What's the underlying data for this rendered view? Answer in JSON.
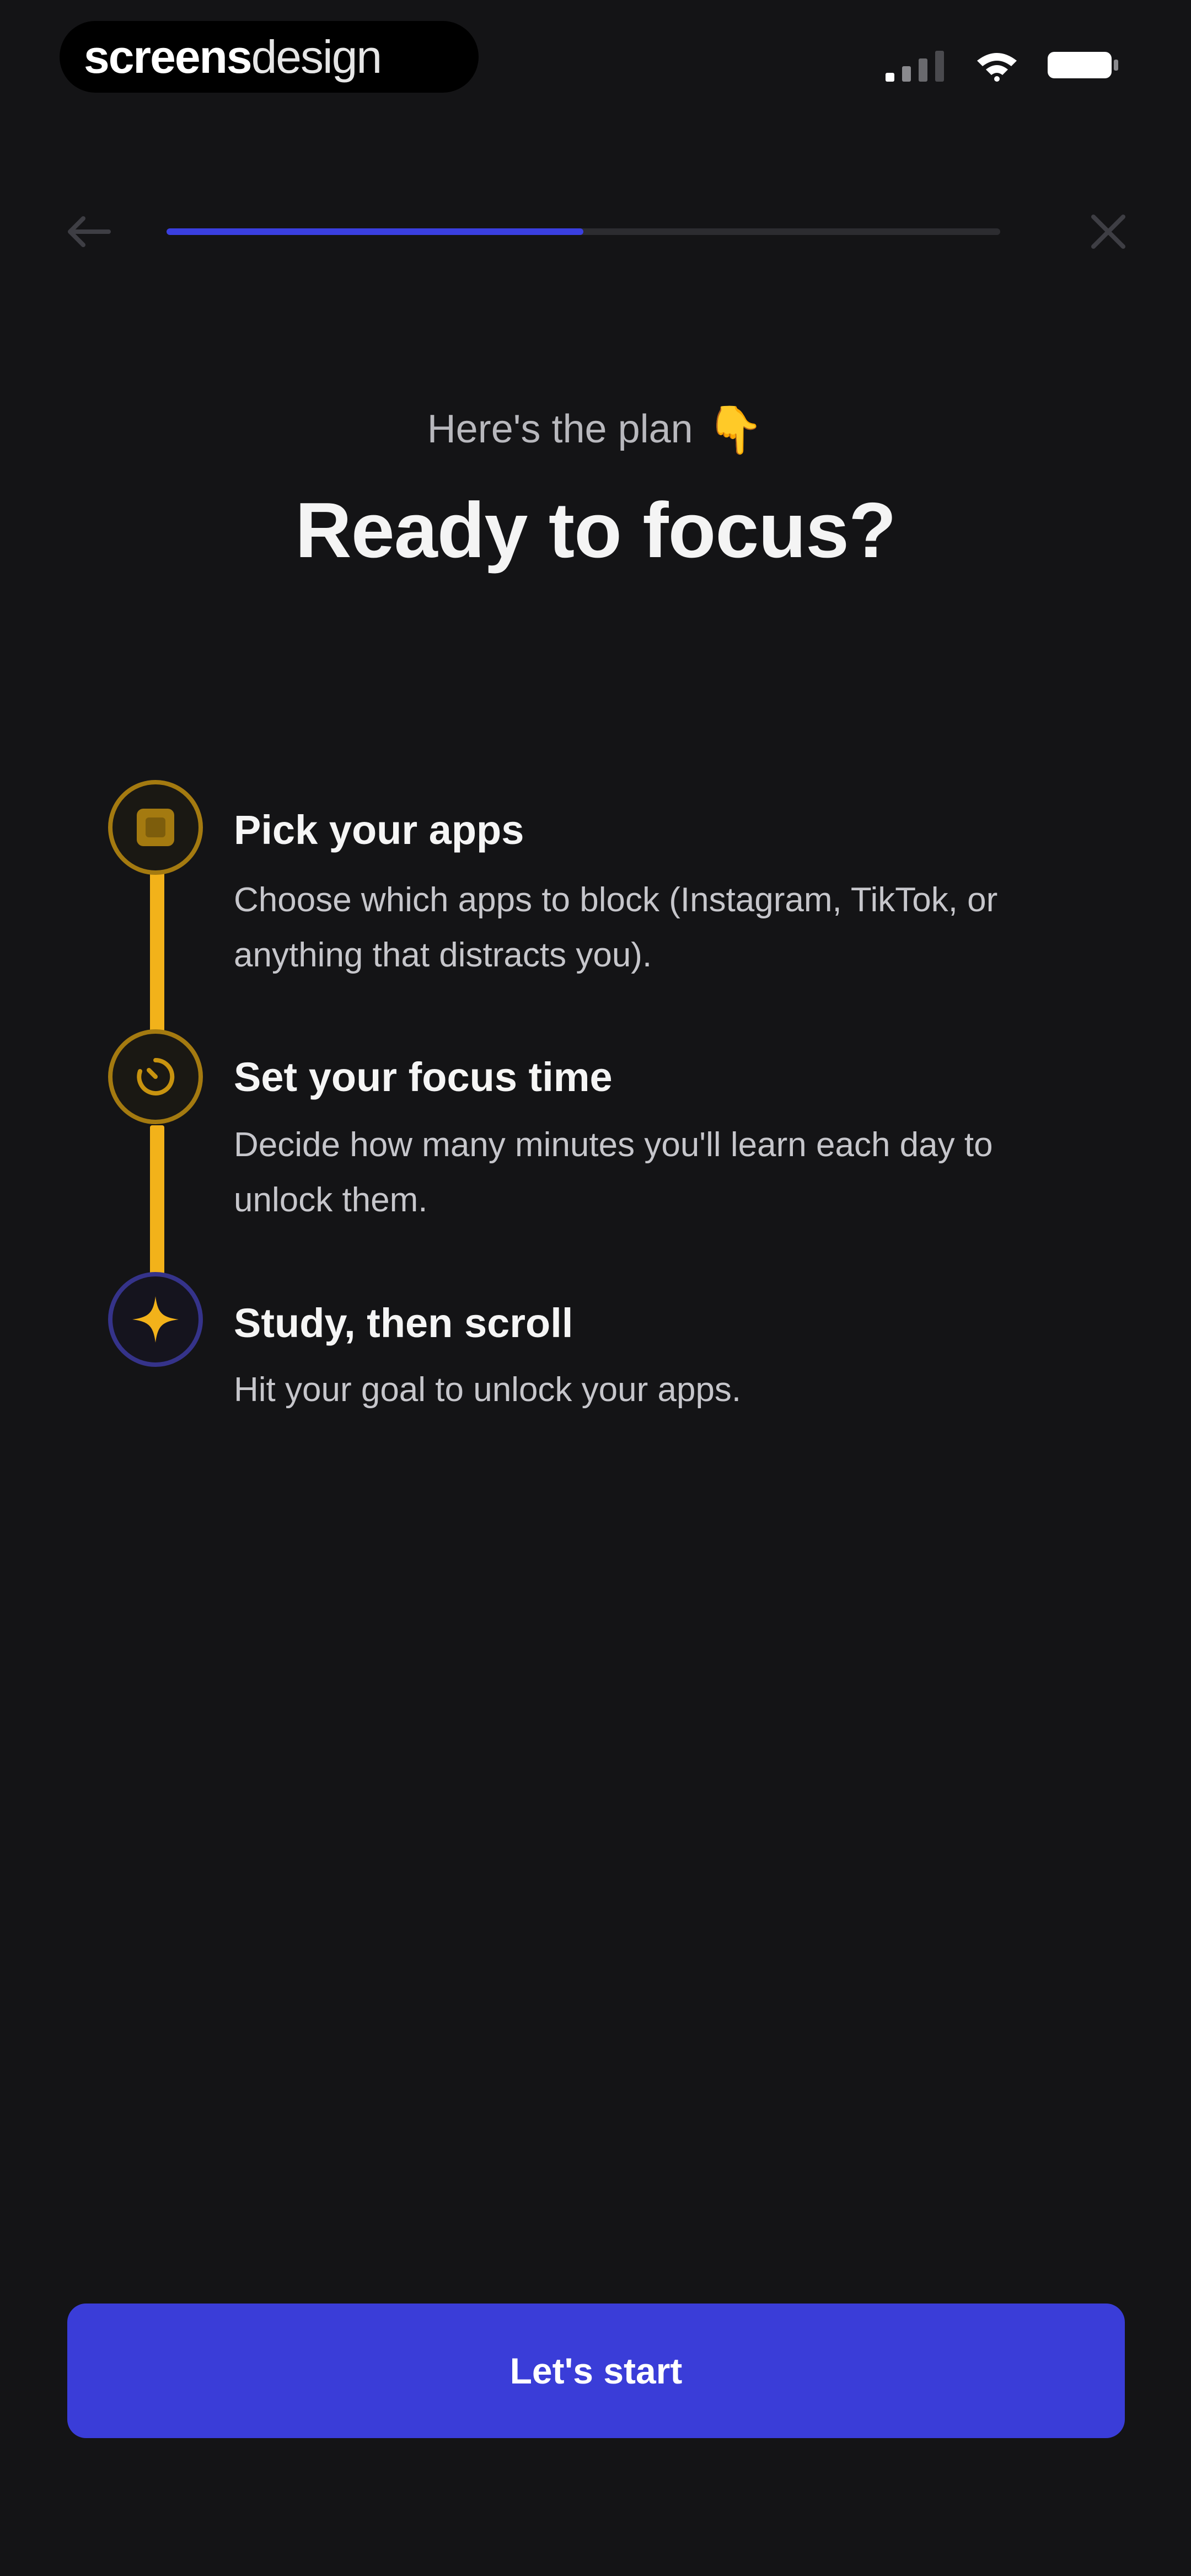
{
  "status_bar": {
    "brand": {
      "bold": "screens",
      "light": "design"
    },
    "icons": [
      "cellular-signal-icon",
      "wifi-icon",
      "battery-icon"
    ]
  },
  "nav": {
    "back_icon": "arrow-left-icon",
    "close_icon": "close-icon",
    "progress_fraction": 0.5
  },
  "header": {
    "eyebrow": "Here's the plan",
    "eyebrow_emoji": "👇",
    "title": "Ready to focus?"
  },
  "steps": [
    {
      "icon": "app-grid-icon",
      "title": "Pick your apps",
      "description": "Choose which apps to block (Instagram, TikTok, or anything that distracts you)."
    },
    {
      "icon": "timer-icon",
      "title": "Set your focus time",
      "description": "Decide how many minutes you'll learn each day to unlock them."
    },
    {
      "icon": "sparkle-icon",
      "title": "Study, then scroll",
      "description": "Hit your goal to unlock your apps."
    }
  ],
  "cta": {
    "label": "Let's start"
  },
  "colors": {
    "background": "#141416",
    "accent_blue": "#3a3dd8",
    "accent_gold": "#f2b21a"
  }
}
